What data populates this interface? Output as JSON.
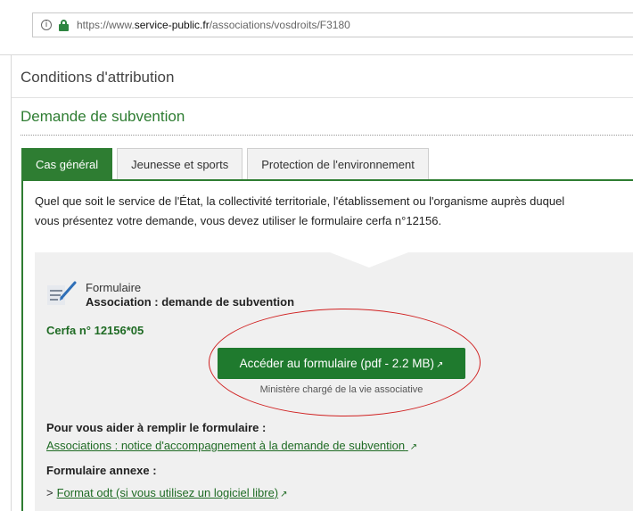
{
  "browser": {
    "url_prefix": "https://www.",
    "url_domain": "service-public.fr",
    "url_path": "/associations/vosdroits/F3180",
    "info_glyph": "i"
  },
  "sections": {
    "conditions": "Conditions d'attribution",
    "demande": "Demande de subvention"
  },
  "tabs": [
    {
      "label": "Cas général",
      "active": true
    },
    {
      "label": "Jeunesse et sports",
      "active": false
    },
    {
      "label": "Protection de l'environnement",
      "active": false
    }
  ],
  "intro": {
    "line1": "Quel que soit le service de l'État, la collectivité territoriale, l'établissement ou l'organisme auprès duquel",
    "line2": "vous présentez votre demande, vous devez utiliser le formulaire cerfa n°12156."
  },
  "form": {
    "icon": "form-edit-icon",
    "label": "Formulaire",
    "name": "Association : demande de subvention",
    "cerfa": "Cerfa n° 12156*05",
    "button_label": "Accéder au formulaire (pdf - 2.2 MB)",
    "ministere": "Ministère chargé de la vie associative",
    "help_title": "Pour vous aider à remplir le formulaire :",
    "help_link": "Associations : notice d'accompagnement à la demande de subvention",
    "annex_title": "Formulaire annexe :",
    "annex_chevron": ">",
    "annex_link": "Format odt (si vous utilisez un logiciel libre)"
  },
  "colors": {
    "accent_green": "#2e7d32",
    "button_green": "#1f7a2e",
    "annotation_red": "#d02020",
    "panel_grey": "#f0f0f0"
  }
}
